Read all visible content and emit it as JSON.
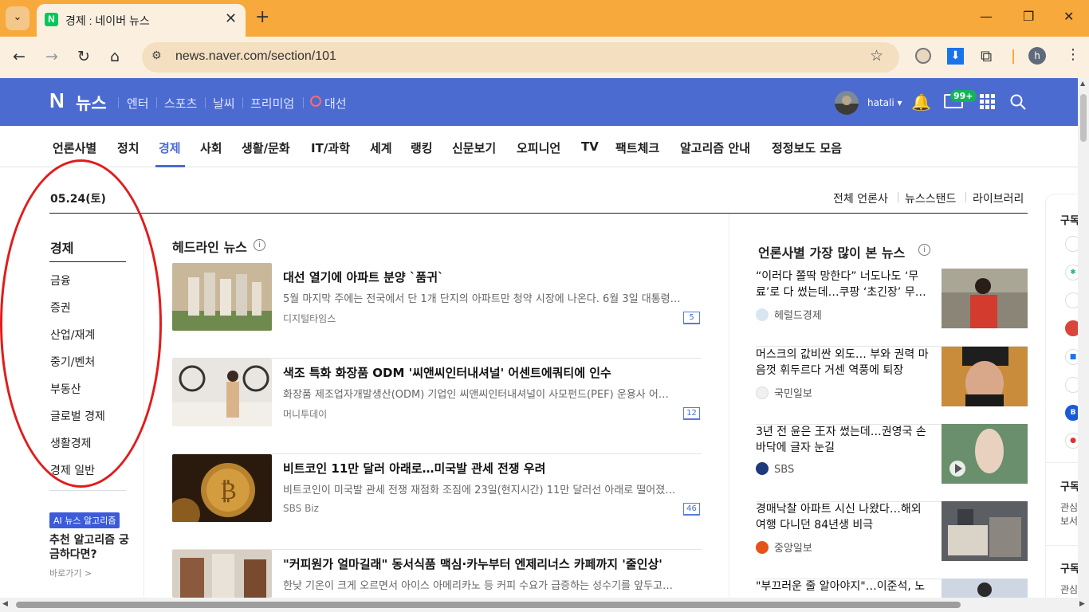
{
  "browser": {
    "tab_title": "경제 : 네이버 뉴스",
    "favicon_letter": "N",
    "url": "news.naver.com/section/101"
  },
  "naver_header": {
    "logo": "N",
    "brand": "뉴스",
    "links": [
      "엔터",
      "스포츠",
      "날씨",
      "프리미엄",
      "대선"
    ],
    "username": "hatali",
    "mail_badge": "99+"
  },
  "categories": [
    "언론사별",
    "정치",
    "경제",
    "사회",
    "생활/문화",
    "IT/과학",
    "세계",
    "랭킹",
    "신문보기",
    "오피니언",
    "TV",
    "팩트체크",
    "알고리즘 안내",
    "정정보도 모음"
  ],
  "active_category": "경제",
  "date": "05.24(토)",
  "top_links": [
    "전체 언론사",
    "뉴스스탠드",
    "라이브러리"
  ],
  "left_menu": {
    "title": "경제",
    "items": [
      "금융",
      "증권",
      "산업/재계",
      "중기/벤처",
      "부동산",
      "글로벌 경제",
      "생활경제",
      "경제 일반"
    ],
    "ai_badge": "AI 뉴스 알고리즘",
    "ai_text": "추천 알고리즘 궁금하다면?",
    "ai_go": "바로가기 >"
  },
  "headline": {
    "title": "헤드라인 뉴스",
    "articles": [
      {
        "title": "대선 열기에 아파트 분양 `품귀`",
        "desc": "5월 마지막 주에는 전국에서 단 1개 단지의 아파트만 청약 시장에 나온다. 6월 3일 대통령…",
        "source": "디지털타임스",
        "count": "5"
      },
      {
        "title": "색조 특화 화장품 ODM '씨앤씨인터내셔널' 어센트에쿼티에 인수",
        "desc": "화장품 제조업자개발생산(ODM) 기업인 씨앤씨인터내셔널이 사모펀드(PEF) 운용사 어…",
        "source": "머니투데이",
        "count": "12"
      },
      {
        "title": "비트코인 11만 달러 아래로…미국발 관세 전쟁 우려",
        "desc": "비트코인이 미국발 관세 전쟁 재점화 조짐에 23일(현지시간) 11만 달러선 아래로 떨어졌…",
        "source": "SBS Biz",
        "count": "46"
      },
      {
        "title": "\"커피원가 얼마길래\" 동서식품 맥심·카누부터 엔제리너스 카페까지 '줄인상'",
        "desc": "한낮 기온이 크게 오르면서 아이스 아메리카노 등 커피 수요가 급증하는 성수기를 앞두고…",
        "source": "",
        "count": ""
      }
    ]
  },
  "most_viewed": {
    "title": "언론사별 가장 많이 본 뉴스",
    "articles": [
      {
        "title": "“이러다 쫄딱 망한다” 너도나도 ‘무료’로 다 썼는데…쿠팡 ‘초긴장’ 무…",
        "source": "헤럴드경제",
        "color": "#d9e6f2"
      },
      {
        "title": "머스크의 값비싼 외도… 부와 권력 마음껏 휘두르다 거센 역풍에 퇴장",
        "source": "국민일보",
        "color": "#f0f0f0"
      },
      {
        "title": "3년 전 윤은 王자 썼는데…권영국 손바닥에 글자 눈길",
        "source": "SBS",
        "color": "#1d3a7a"
      },
      {
        "title": "경매낙찰 아파트 시신 나왔다…해외여행 다니던 84년생 비극",
        "source": "중앙일보",
        "color": "#e5531a"
      },
      {
        "title": "\"부끄러운 줄 알아야지\"…이준석, 노",
        "source": "",
        "color": "#ffffff"
      }
    ]
  },
  "far_right": {
    "title1": "구독",
    "title2": "구독",
    "sub2": "관심 보서",
    "title3": "구독",
    "sub3": "관심"
  },
  "colors": {
    "naver_blue": "#4c6bd1",
    "chrome_orange": "#f7a93b",
    "highlight_red": "#e11c1c"
  }
}
